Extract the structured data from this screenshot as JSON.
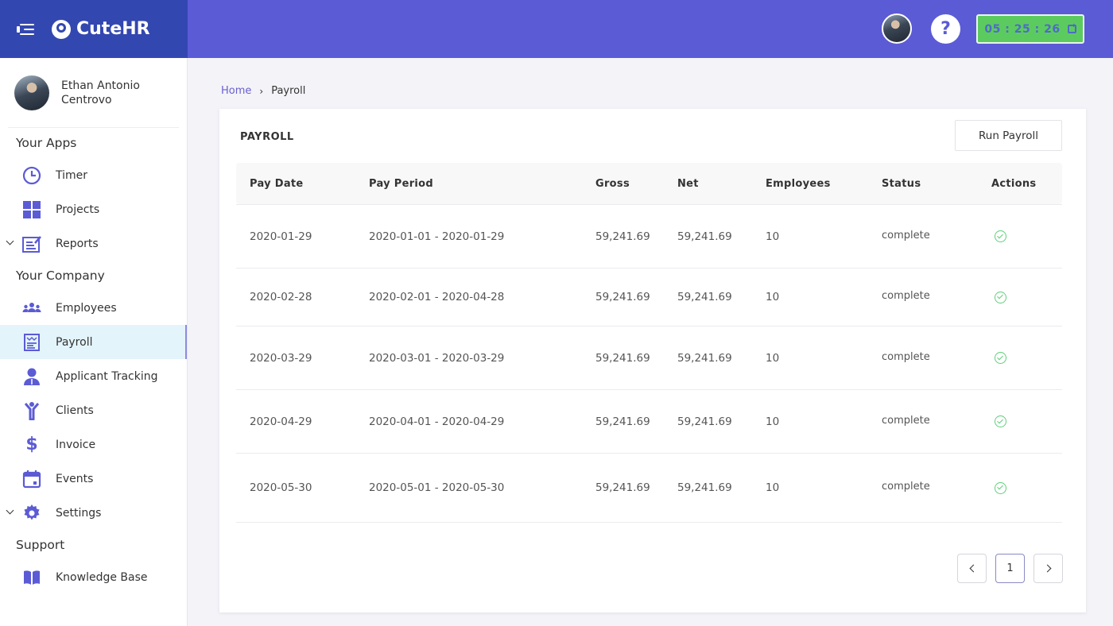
{
  "app": {
    "name": "CuteHR"
  },
  "header": {
    "timer": "05 : 25 : 26",
    "help_label": "?"
  },
  "user": {
    "name_line1": "Ethan Antonio",
    "name_line2": "Centrovo"
  },
  "sidebar": {
    "sections": [
      {
        "title": "Your Apps"
      },
      {
        "title": "Your Company"
      },
      {
        "title": "Support"
      }
    ],
    "items": [
      {
        "label": "Timer",
        "icon": "clock-icon"
      },
      {
        "label": "Projects",
        "icon": "grid-icon"
      },
      {
        "label": "Reports",
        "icon": "report-edit-icon",
        "expandable": true
      },
      {
        "label": "Employees",
        "icon": "users-icon"
      },
      {
        "label": "Payroll",
        "icon": "payroll-receipt-icon",
        "active": true
      },
      {
        "label": "Applicant Tracking",
        "icon": "applicant-icon"
      },
      {
        "label": "Clients",
        "icon": "person-arms-up-icon"
      },
      {
        "label": "Invoice",
        "icon": "dollar-icon"
      },
      {
        "label": "Events",
        "icon": "calendar-icon"
      },
      {
        "label": "Settings",
        "icon": "gear-icon",
        "expandable": true
      },
      {
        "label": "Knowledge Base",
        "icon": "book-icon"
      }
    ]
  },
  "breadcrumb": {
    "home": "Home",
    "separator": "›",
    "current": "Payroll"
  },
  "card": {
    "title": "PAYROLL",
    "run_button": "Run Payroll"
  },
  "table": {
    "columns": [
      "Pay Date",
      "Pay Period",
      "Gross",
      "Net",
      "Employees",
      "Status",
      "Actions"
    ],
    "rows": [
      {
        "pay_date": "2020-01-29",
        "pay_period": "2020-01-01 - 2020-01-29",
        "gross": "59,241.69",
        "net": "59,241.69",
        "employees": "10",
        "status": "complete"
      },
      {
        "pay_date": "2020-02-28",
        "pay_period": "2020-02-01 - 2020-04-28",
        "gross": "59,241.69",
        "net": "59,241.69",
        "employees": "10",
        "status": "complete"
      },
      {
        "pay_date": "2020-03-29",
        "pay_period": "2020-03-01 - 2020-03-29",
        "gross": "59,241.69",
        "net": "59,241.69",
        "employees": "10",
        "status": "complete"
      },
      {
        "pay_date": "2020-04-29",
        "pay_period": "2020-04-01 - 2020-04-29",
        "gross": "59,241.69",
        "net": "59,241.69",
        "employees": "10",
        "status": "complete"
      },
      {
        "pay_date": "2020-05-30",
        "pay_period": "2020-05-01 - 2020-05-30",
        "gross": "59,241.69",
        "net": "59,241.69",
        "employees": "10",
        "status": "complete"
      }
    ]
  },
  "pagination": {
    "current_page": "1"
  },
  "colors": {
    "brand_dark": "#3347b0",
    "topbar": "#5b5bd6",
    "timer_bg": "#5ccb5f",
    "status_ok": "#5fcf7a",
    "active_nav_bg": "#e4f4fb"
  }
}
